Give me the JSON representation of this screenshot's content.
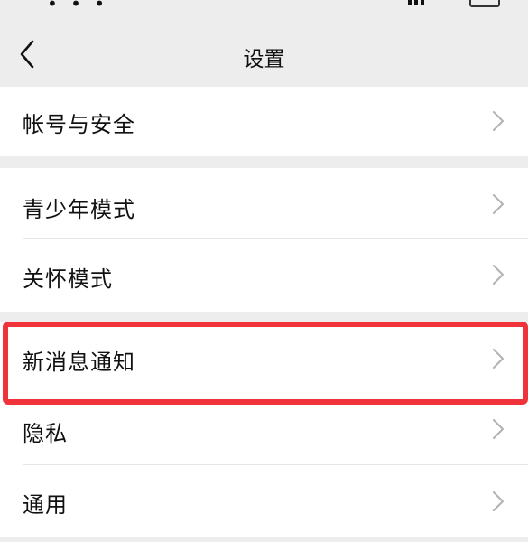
{
  "header": {
    "title": "设置"
  },
  "groups": [
    {
      "items": [
        {
          "label": "帐号与安全"
        }
      ]
    },
    {
      "items": [
        {
          "label": "青少年模式"
        },
        {
          "label": "关怀模式"
        }
      ]
    },
    {
      "items": [
        {
          "label": "新消息通知"
        },
        {
          "label": "隐私"
        },
        {
          "label": "通用"
        }
      ]
    }
  ],
  "icons": {
    "back": "chevron-left-icon",
    "row_arrow": "chevron-right-icon"
  },
  "colors": {
    "background": "#ededed",
    "row_background": "#ffffff",
    "highlight_border": "#f0333a",
    "chevron": "#b2b2b2"
  },
  "highlighted_item": "新消息通知"
}
